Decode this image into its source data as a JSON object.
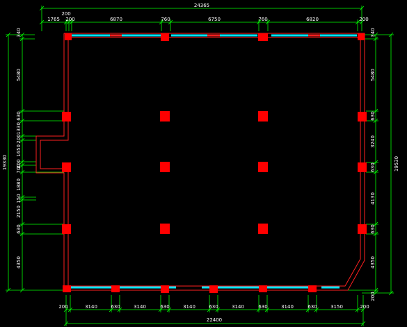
{
  "drawing": {
    "colors": {
      "background": "#000000",
      "dimension": "#00ff00",
      "wall": "#ff2020",
      "column": "#ff0000",
      "window": "#00e5ff",
      "text": "#ffffff"
    },
    "top": {
      "overall": "24365",
      "segments": [
        "1765",
        "200",
        "200",
        "6870",
        "760",
        "6750",
        "760",
        "6820",
        "200"
      ]
    },
    "bottom": {
      "overall": "22400",
      "segments": [
        "200",
        "3140",
        "630",
        "3140",
        "630",
        "3140",
        "630",
        "3140",
        "630",
        "3140",
        "630",
        "3150",
        "200"
      ]
    },
    "left": {
      "overall": "19330",
      "segments": [
        "340",
        "5480",
        "630",
        "1330",
        "200",
        "1650",
        "200",
        "700",
        "1880",
        "150",
        "2150",
        "630",
        "4350"
      ]
    },
    "right": {
      "overall": "19530",
      "segments": [
        "340",
        "5480",
        "630",
        "3240",
        "630",
        "4130",
        "630",
        "4350",
        "200"
      ]
    }
  }
}
